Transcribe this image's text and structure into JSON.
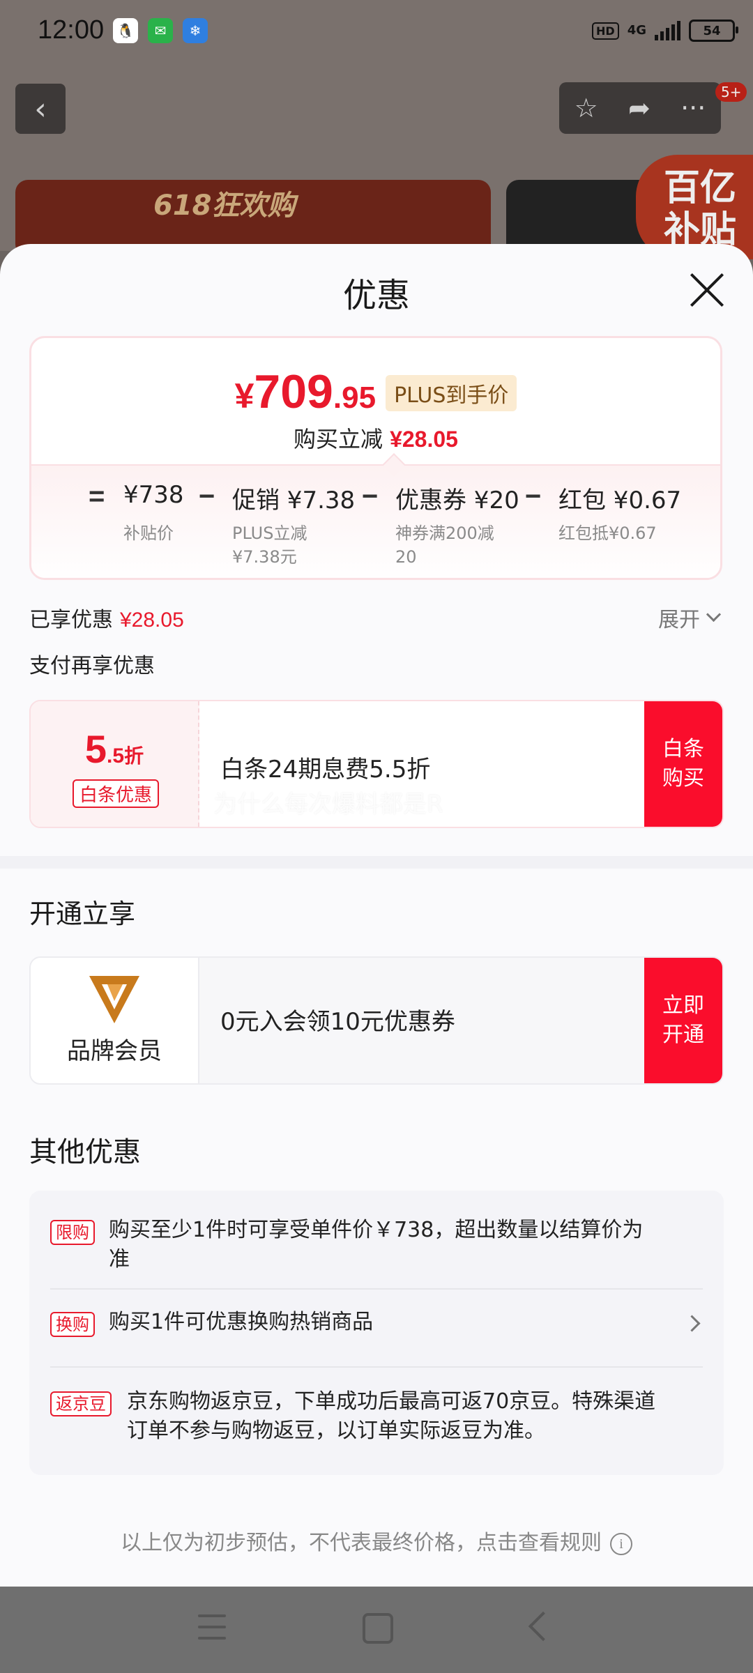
{
  "status_bar": {
    "time": "12:00",
    "apps": [
      "qq-icon",
      "wechat-icon",
      "weather-icon"
    ],
    "hd": "HD",
    "network": "4G",
    "battery": "54"
  },
  "background_page": {
    "badge": "5+",
    "banner_text": "618狂欢购",
    "subsidy_text": "百亿补贴"
  },
  "sheet": {
    "title": "优惠",
    "price_card": {
      "final_yen": "¥",
      "final_int": "709",
      "final_dec": ".95",
      "plus_tag": "PLUS到手价",
      "instant_label": "购买立减",
      "instant_value": "¥28.05",
      "breakdown": {
        "equals": "=",
        "minus": "−",
        "items": [
          {
            "value": "¥738",
            "label": "补贴价"
          },
          {
            "value": "促销 ¥7.38",
            "label": "PLUS立减¥7.38元"
          },
          {
            "value": "优惠券 ¥20",
            "label": "神券满200减20"
          },
          {
            "value": "红包 ¥0.67",
            "label": "红包抵¥0.67"
          }
        ]
      }
    },
    "enjoyed_label": "已享优惠",
    "enjoyed_value": "¥28.05",
    "expand_label": "展开",
    "pay_more_label": "支付再享优惠",
    "baitiao": {
      "rate_big": "5",
      "rate_small": ".5",
      "rate_unit": "折",
      "tag": "白条优惠",
      "desc": "白条24期息费5.5折",
      "watermark": "为什么每次爆料都是R",
      "button": "白条购买"
    },
    "open_title": "开通立享",
    "member": {
      "label": "品牌会员",
      "desc": "0元入会领10元优惠券",
      "button": "立即开通"
    },
    "other_title": "其他优惠",
    "other_items": [
      {
        "tag": "限购",
        "text": "购买至少1件时可享受单件价￥738，超出数量以结算价为准"
      },
      {
        "tag": "换购",
        "text": "购买1件可优惠换购热销商品"
      },
      {
        "tag": "返京豆",
        "text": "京东购物返京豆，下单成功后最高可返70京豆。特殊渠道订单不参与购物返豆，以订单实际返豆为准。"
      }
    ],
    "footer_note": "以上仅为初步预估，不代表最终价格，点击查看规则"
  },
  "colors": {
    "accent_red": "#e8192c",
    "button_red": "#fa0d2c",
    "plus_tag_bg": "#fbebd1",
    "member_gold": "#c87a1c"
  }
}
